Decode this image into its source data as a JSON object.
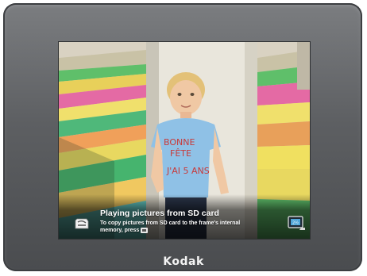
{
  "device": {
    "brand_label": "Kodak"
  },
  "notification": {
    "title": "Playing pictures from SD card",
    "message": "To copy pictures from SD card to the frame's internal memory, press",
    "source_icon": "sd-card-icon",
    "copy_button_icon": "copy-button-icon",
    "memory_icon": "internal-memory-icon"
  },
  "colors": {
    "frame": "#5d5f62",
    "caption_text": "#ffffff"
  }
}
